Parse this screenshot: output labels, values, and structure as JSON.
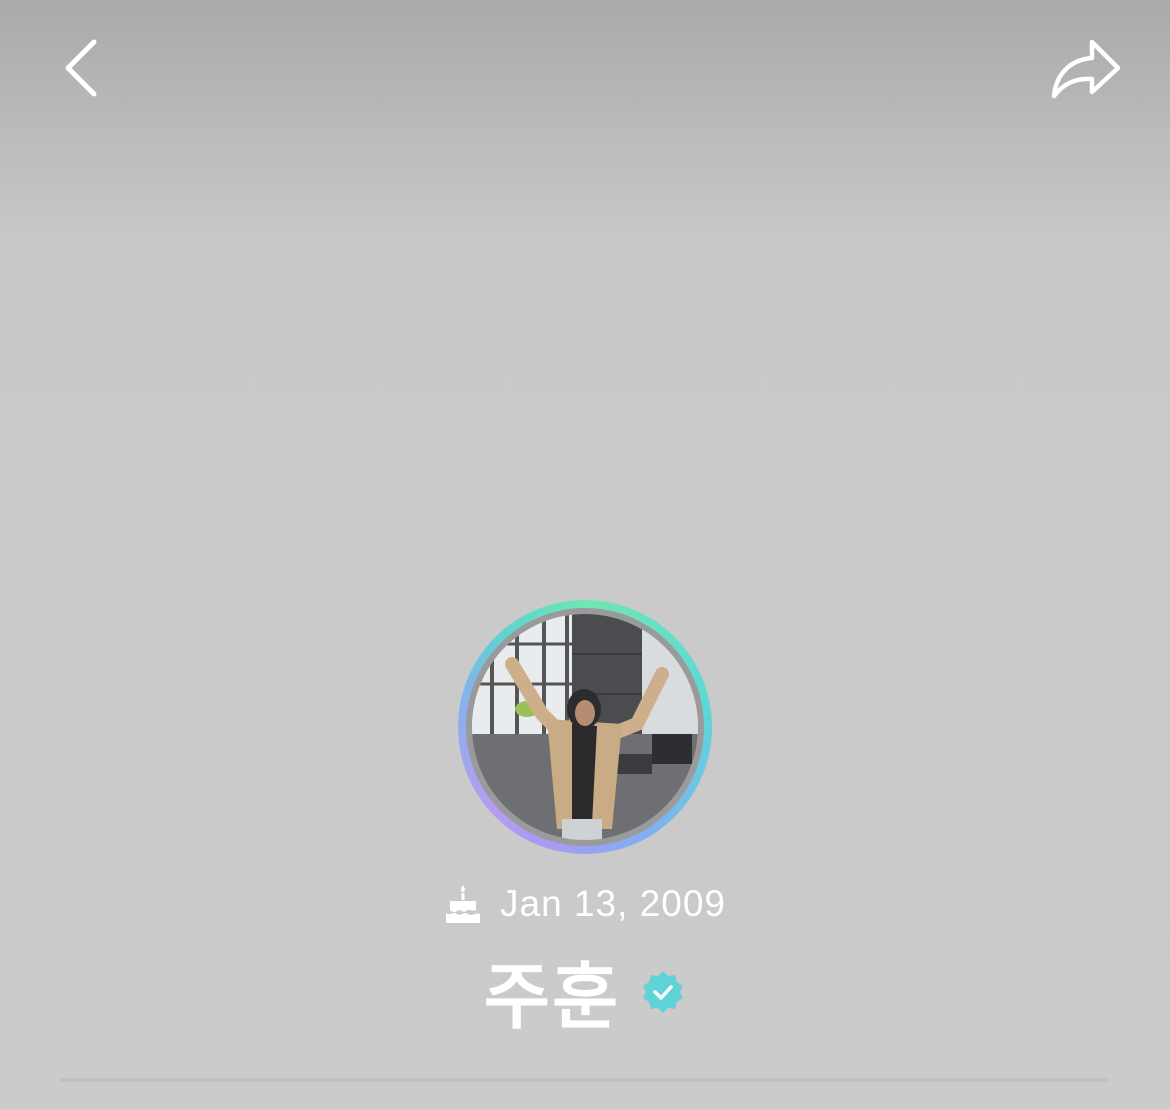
{
  "header": {
    "back_icon": "chevron-left-icon",
    "share_icon": "share-arrow-icon"
  },
  "profile": {
    "avatar_ring_colors": [
      "#6ee6b4",
      "#5ed8d6",
      "#7fb0f0",
      "#b69cf0"
    ],
    "birthday_icon": "cake-icon",
    "birthday": "Jan 13, 2009",
    "name": "주훈",
    "verified_icon": "verified-badge-icon",
    "verified_color": "#5fd3d8"
  }
}
